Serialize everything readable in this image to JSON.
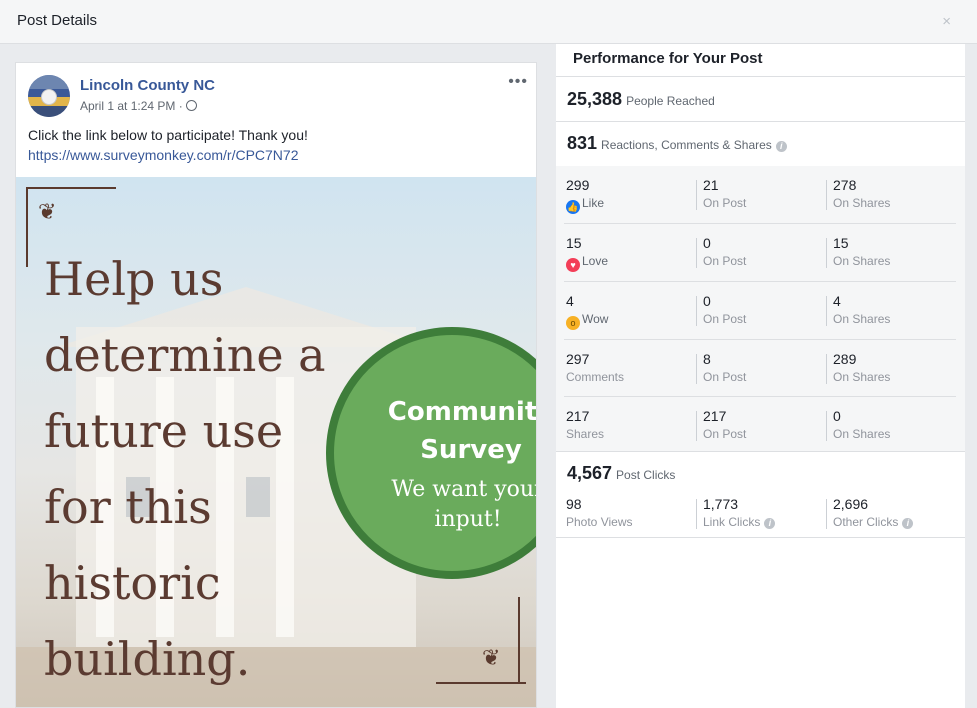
{
  "header": {
    "title": "Post Details",
    "close_label": "×"
  },
  "post": {
    "page_name": "Lincoln County NC",
    "timestamp": "April 1 at 1:24 PM ·",
    "more_label": "•••",
    "text": "Click the link below to participate! Thank you!",
    "link": "https://www.surveymonkey.com/r/CPC7N72",
    "image": {
      "headline": [
        "Help us",
        "determine a",
        "future use",
        "for this",
        "historic",
        "building."
      ],
      "badge_title": [
        "Community",
        "Survey"
      ],
      "badge_subtitle": [
        "We want your",
        "input!"
      ]
    }
  },
  "performance": {
    "title": "Performance for Your Post",
    "people_reached": {
      "value": "25,388",
      "label": "People Reached"
    },
    "engagement": {
      "value": "831",
      "label": "Reactions, Comments & Shares"
    },
    "rows": [
      {
        "total": "299",
        "total_label": "Like",
        "icon": "like-icon",
        "on_post": "21",
        "on_post_label": "On Post",
        "on_shares": "278",
        "on_shares_label": "On Shares"
      },
      {
        "total": "15",
        "total_label": "Love",
        "icon": "love-icon",
        "on_post": "0",
        "on_post_label": "On Post",
        "on_shares": "15",
        "on_shares_label": "On Shares"
      },
      {
        "total": "4",
        "total_label": "Wow",
        "icon": "wow-icon",
        "on_post": "0",
        "on_post_label": "On Post",
        "on_shares": "4",
        "on_shares_label": "On Shares"
      },
      {
        "total": "297",
        "total_label": "Comments",
        "icon": "",
        "on_post": "8",
        "on_post_label": "On Post",
        "on_shares": "289",
        "on_shares_label": "On Shares"
      },
      {
        "total": "217",
        "total_label": "Shares",
        "icon": "",
        "on_post": "217",
        "on_post_label": "On Post",
        "on_shares": "0",
        "on_shares_label": "On Shares"
      }
    ],
    "post_clicks": {
      "value": "4,567",
      "label": "Post Clicks"
    },
    "clicks": [
      {
        "value": "98",
        "label": "Photo Views"
      },
      {
        "value": "1,773",
        "label": "Link Clicks"
      },
      {
        "value": "2,696",
        "label": "Other Clicks"
      }
    ]
  }
}
